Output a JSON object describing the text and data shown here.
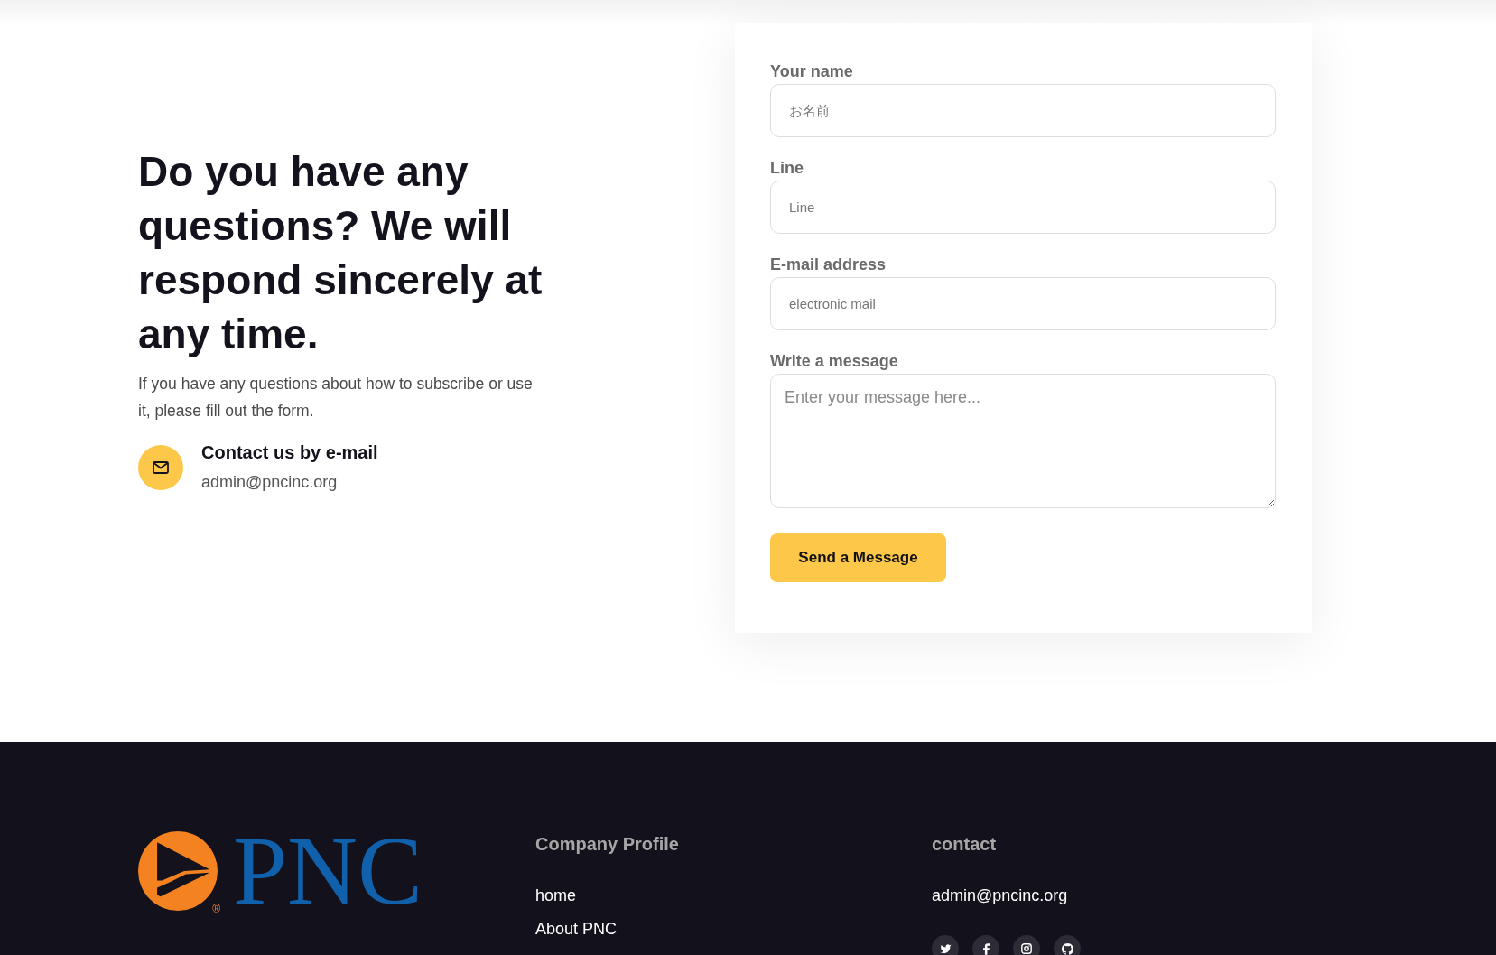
{
  "intro": {
    "heading": "Do you have any questions? We will respond sincerely at any time.",
    "description": "If you have any questions about how to subscribe or use it, please fill out the form.",
    "contact": {
      "title": "Contact us by e-mail",
      "email": "admin@pncinc.org"
    }
  },
  "form": {
    "fields": [
      {
        "kind": "input",
        "label": "Your name",
        "placeholder": "お名前"
      },
      {
        "kind": "input",
        "label": "Line",
        "placeholder": "Line"
      },
      {
        "kind": "input",
        "label": "E-mail address",
        "placeholder": "electronic mail"
      },
      {
        "kind": "textarea",
        "label": "Write a message",
        "placeholder": "Enter your message here..."
      }
    ],
    "submit": "Send a Message"
  },
  "footer": {
    "logo": {
      "wordmark": "PNC",
      "registered_mark": "®"
    },
    "columns": [
      {
        "heading": "Company Profile",
        "links": [
          "home",
          "About PNC"
        ]
      },
      {
        "heading": "contact",
        "links": [
          "admin@pncinc.org"
        ],
        "social_links": [
          {
            "kind": "bird"
          },
          {
            "kind": "letter-f"
          },
          {
            "kind": "camera"
          },
          {
            "kind": "cat"
          }
        ]
      }
    ]
  }
}
